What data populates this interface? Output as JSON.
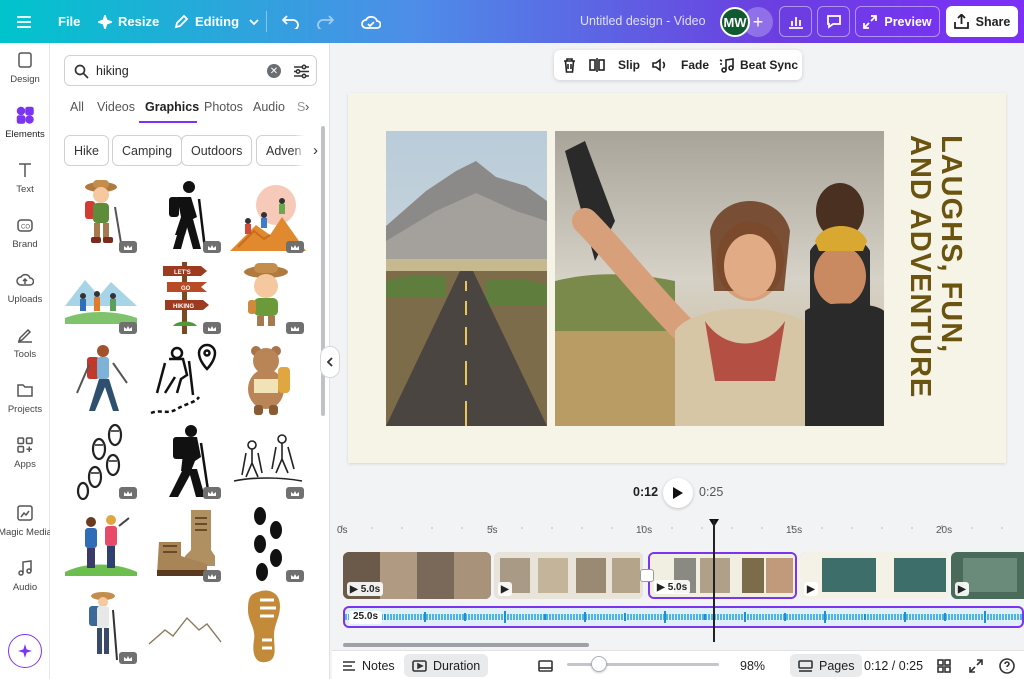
{
  "topbar": {
    "file_label": "File",
    "resize_label": "Resize",
    "editing_label": "Editing",
    "doc_title": "Untitled design - Video",
    "avatar_initials": "MW",
    "preview_label": "Preview",
    "share_label": "Share"
  },
  "rail": {
    "items": [
      "Design",
      "Elements",
      "Text",
      "Brand",
      "Uploads",
      "Tools",
      "Projects",
      "Apps",
      "Magic Media",
      "Audio"
    ]
  },
  "panel": {
    "search_value": "hiking",
    "tabs": [
      "All",
      "Videos",
      "Graphics",
      "Photos",
      "Audio",
      "S"
    ],
    "active_tab": "Graphics",
    "chips": [
      "Hike",
      "Camping",
      "Outdoors",
      "Adven"
    ]
  },
  "context_toolbar": {
    "slip_label": "Slip",
    "fade_label": "Fade",
    "beat_sync_label": "Beat Sync"
  },
  "design": {
    "vertical_text_line1": "LAUGHS, FUN,",
    "vertical_text_line2": "AND ADVENTURE"
  },
  "playback": {
    "current_time": "0:12",
    "total_time": "0:25"
  },
  "timeline": {
    "ruler": [
      "0s",
      "5s",
      "10s",
      "15s",
      "20s"
    ],
    "clips": [
      {
        "duration": "5.0s"
      },
      {
        "duration": ""
      },
      {
        "duration": "5.0s"
      },
      {
        "duration": ""
      },
      {
        "duration": ""
      }
    ],
    "audio_duration": "25.0s"
  },
  "bottombar": {
    "notes_label": "Notes",
    "duration_label": "Duration",
    "zoom": "98%",
    "pages_label": "Pages",
    "time": "0:12 / 0:25"
  },
  "colors": {
    "accent": "#7b35f1",
    "canvas_bg": "#f5f4e6",
    "headline": "#6b5410"
  }
}
